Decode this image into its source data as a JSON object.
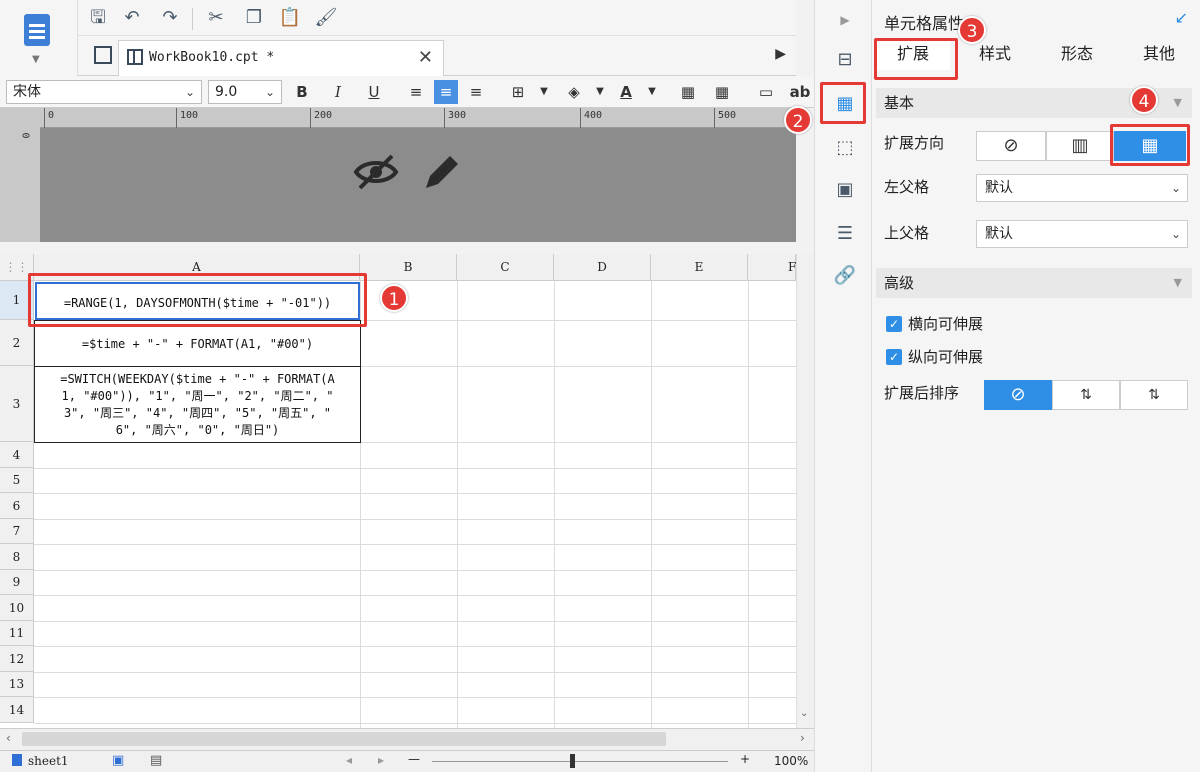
{
  "tab": {
    "title": "WorkBook10.cpt *"
  },
  "font": {
    "family": "宋体",
    "size": "9.0"
  },
  "format_toolbar": {
    "bold": "B",
    "italic": "I",
    "underline": "U",
    "text_label": "ab"
  },
  "ruler": {
    "marks": [
      "0",
      "100",
      "200",
      "300",
      "400",
      "500"
    ]
  },
  "columns": [
    "A",
    "B",
    "C",
    "D",
    "E",
    "F"
  ],
  "rows": [
    "1",
    "2",
    "3",
    "4",
    "5",
    "6",
    "7",
    "8",
    "9",
    "10",
    "11",
    "12",
    "13",
    "14"
  ],
  "cells": {
    "a1": "=RANGE(1, DAYSOFMONTH($time + \"-01\"))",
    "a2": "=$time + \"-\" + FORMAT(A1, \"#00\")",
    "a3_line1": "=SWITCH(WEEKDAY($time + \"-\" + FORMAT(A",
    "a3_line2": "1, \"#00\")), \"1\", \"周一\", \"2\", \"周二\", \"",
    "a3_line3": "3\", \"周三\", \"4\", \"周四\", \"5\", \"周五\", \"",
    "a3_line4": "6\", \"周六\", \"0\", \"周日\")"
  },
  "bottom": {
    "sheet": "sheet1",
    "zoom": "100%",
    "minus": "—",
    "plus": "+"
  },
  "panel": {
    "title": "单元格属性",
    "tabs": [
      "扩展",
      "样式",
      "形态",
      "其他"
    ],
    "basic": "基本",
    "expand_direction": "扩展方向",
    "left_parent": "左父格",
    "left_parent_value": "默认",
    "top_parent": "上父格",
    "top_parent_value": "默认",
    "advanced": "高级",
    "horizontal_extend": "横向可伸展",
    "vertical_extend": "纵向可伸展",
    "sort_after": "扩展后排序"
  },
  "badges": [
    "1",
    "2",
    "3",
    "4"
  ],
  "colors": {
    "accent": "#2f8ee5",
    "annotation": "#e53935"
  }
}
